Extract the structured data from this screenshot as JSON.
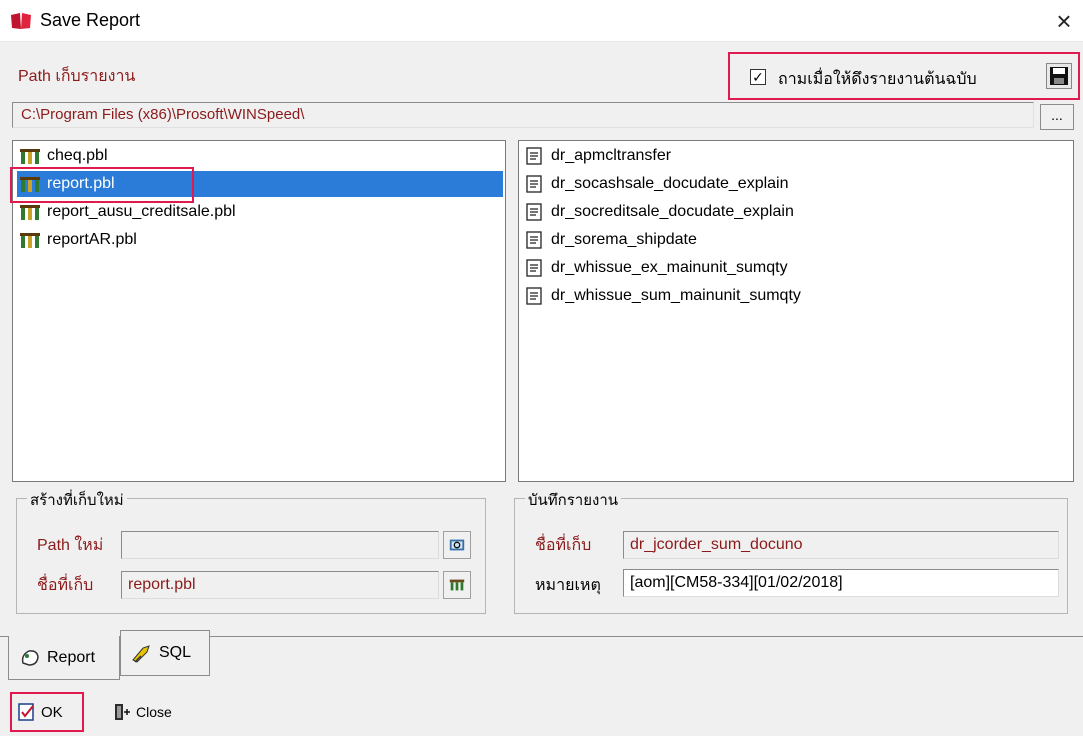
{
  "window": {
    "title": "Save Report",
    "close": "×"
  },
  "path_section": {
    "label": "Path เก็บรายงาน",
    "value": "C:\\Program Files (x86)\\Prosoft\\WINSpeed\\",
    "browse_label": "..."
  },
  "ask_option": {
    "checked_mark": "✓",
    "label": "ถามเมื่อให้ดึงรายงานต้นฉบับ"
  },
  "libraries": [
    {
      "name": "cheq.pbl",
      "selected": false
    },
    {
      "name": "report.pbl",
      "selected": true
    },
    {
      "name": "report_ausu_creditsale.pbl",
      "selected": false
    },
    {
      "name": "reportAR.pbl",
      "selected": false
    }
  ],
  "reports": [
    "dr_apmcltransfer",
    "dr_socashsale_docudate_explain",
    "dr_socreditsale_docudate_explain",
    "dr_sorema_shipdate",
    "dr_whissue_ex_mainunit_sumqty",
    "dr_whissue_sum_mainunit_sumqty"
  ],
  "new_location": {
    "title": "สร้างที่เก็บใหม่",
    "path_label": "Path ใหม่",
    "path_value": "",
    "name_label": "ชื่อที่เก็บ",
    "name_value": "report.pbl"
  },
  "save_report": {
    "title": "บันทึกรายงาน",
    "name_label": "ชื่อที่เก็บ",
    "name_value": "dr_jcorder_sum_docuno",
    "note_label": "หมายเหตุ",
    "note_value": "[aom][CM58-334][01/02/2018]"
  },
  "tabs": {
    "report": "Report",
    "sql": "SQL"
  },
  "buttons": {
    "ok": "OK",
    "close": "Close"
  },
  "colors": {
    "selection": "#2b7bd8",
    "highlight": "#e0194e",
    "label_red": "#8b1a1a"
  }
}
